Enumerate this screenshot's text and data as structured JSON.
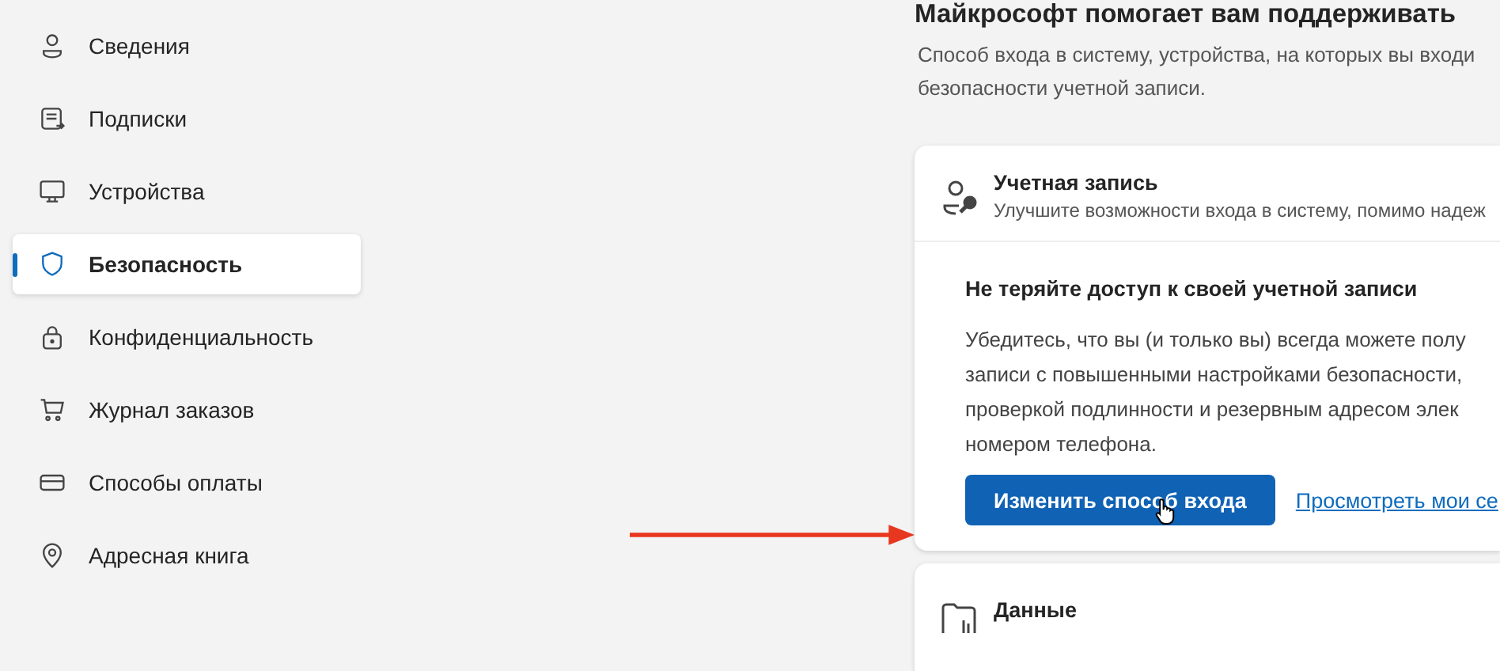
{
  "sidebar": {
    "items": [
      {
        "label": "Сведения",
        "kind": "person",
        "selected": false
      },
      {
        "label": "Подписки",
        "kind": "subscription",
        "selected": false
      },
      {
        "label": "Устройства",
        "kind": "monitor",
        "selected": false
      },
      {
        "label": "Безопасность",
        "kind": "shield",
        "selected": true
      },
      {
        "label": "Конфиденциальность",
        "kind": "lock",
        "selected": false
      },
      {
        "label": "Журнал заказов",
        "kind": "cart",
        "selected": false
      },
      {
        "label": "Способы оплаты",
        "kind": "card",
        "selected": false
      },
      {
        "label": "Адресная книга",
        "kind": "pin",
        "selected": false
      }
    ]
  },
  "main": {
    "heading": "Майкрософт помогает вам поддерживать",
    "intro": "Способ входа в систему, устройства, на которых вы входи\nбезопасности учетной записи.",
    "account_card": {
      "title": "Учетная запись",
      "subtitle": "Улучшите возможности входа в систему, помимо надеж",
      "section_title": "Не теряйте доступ к своей учетной записи",
      "body": "Убедитесь, что вы (и только вы) всегда можете полу\nзаписи с повышенными настройками безопасности,\nпроверкой подлинности и резервным адресом элек\nномером телефона.",
      "primary_button": "Изменить способ входа",
      "link": "Просмотреть мои се"
    },
    "data_card": {
      "title": "Данные"
    }
  }
}
